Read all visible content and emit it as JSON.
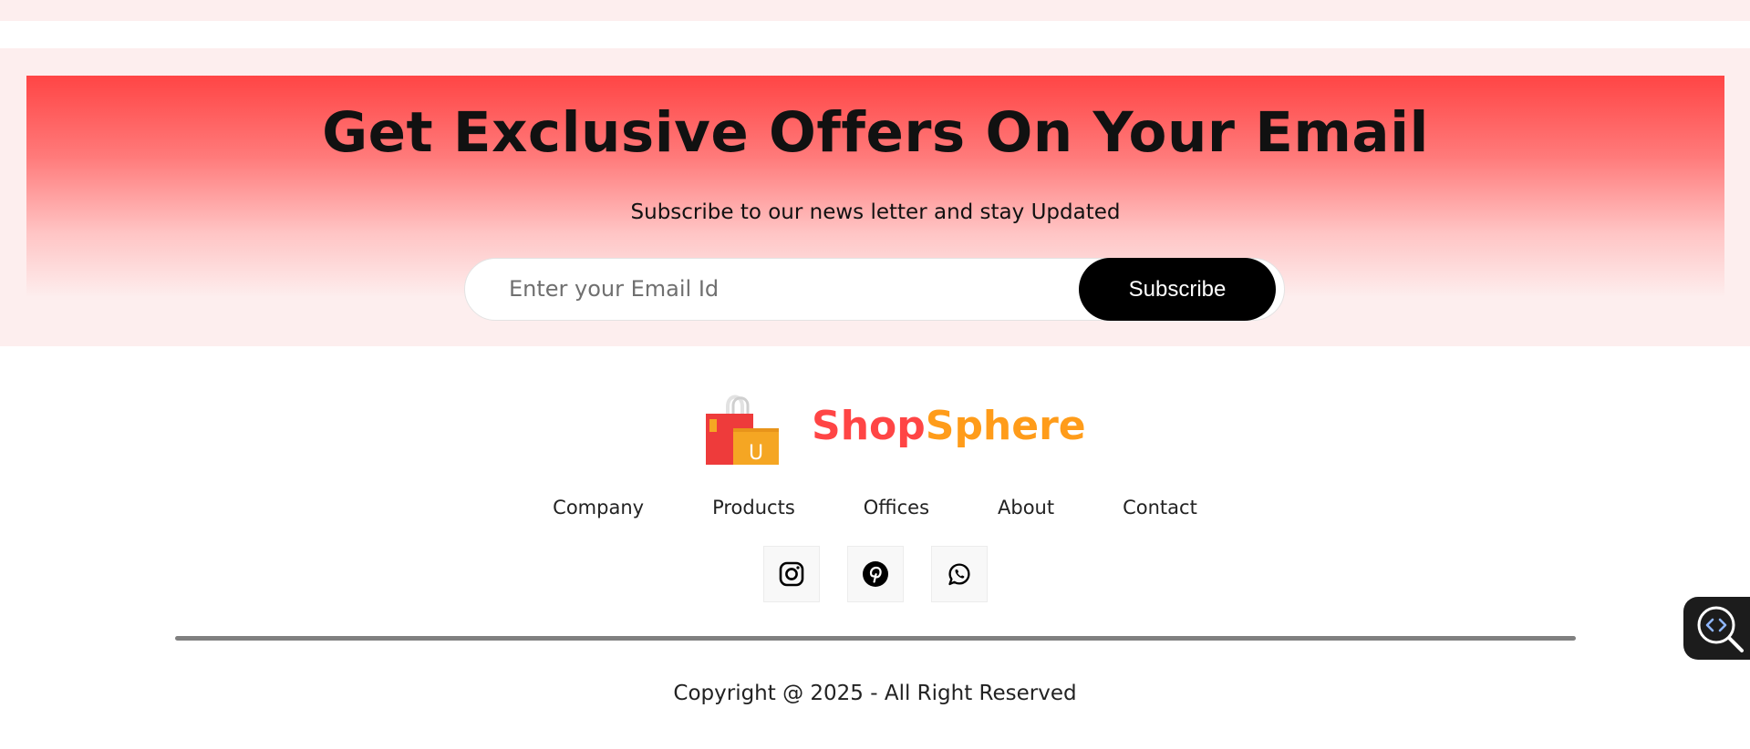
{
  "offers": {
    "title": "Get Exclusive Offers On Your Email",
    "subtitle": "Subscribe to our news letter and stay Updated",
    "email_placeholder": "Enter your Email Id",
    "subscribe_label": "Subscribe"
  },
  "brand": {
    "name_part1": "Shop",
    "name_part2": "Sphere",
    "bag_letter": "U",
    "colors": {
      "part1": "#ff4545",
      "part2": "#ff9c1a"
    }
  },
  "nav": {
    "items": [
      "Company",
      "Products",
      "Offices",
      "About",
      "Contact"
    ]
  },
  "social": {
    "icons": [
      "instagram-icon",
      "pinterest-icon",
      "whatsapp-icon"
    ]
  },
  "footer": {
    "copyright": "Copyright @ 2025 - All Right Reserved"
  },
  "widget": {
    "icon": "code-search-icon"
  },
  "colors": {
    "accent": "#ff4545",
    "band_bg": "#fdeeee",
    "button": "#000000"
  }
}
